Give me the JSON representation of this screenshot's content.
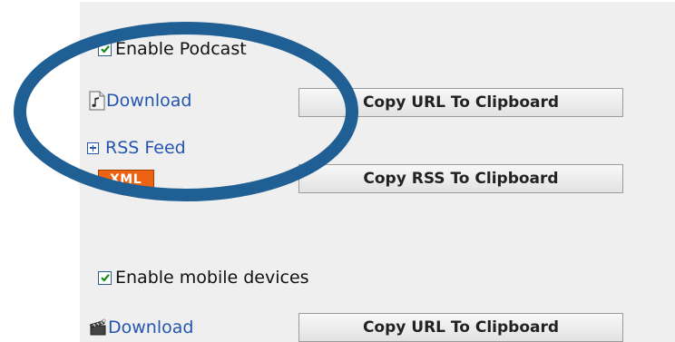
{
  "podcast": {
    "enable_label": "Enable Podcast",
    "enabled": true,
    "download_label": "Download",
    "copy_url_button": "Copy URL To Clipboard",
    "rss_label": "RSS Feed",
    "xml_badge": "XML",
    "copy_rss_button": "Copy RSS To Clipboard"
  },
  "mobile": {
    "enable_label": "Enable mobile devices",
    "enabled": true,
    "download_label": "Download",
    "copy_url_button": "Copy URL To Clipboard"
  },
  "colors": {
    "panel_bg": "#efefef",
    "link": "#2456b0",
    "annotation_ellipse": "#1f5f94",
    "xml_badge": "#ee6311"
  }
}
